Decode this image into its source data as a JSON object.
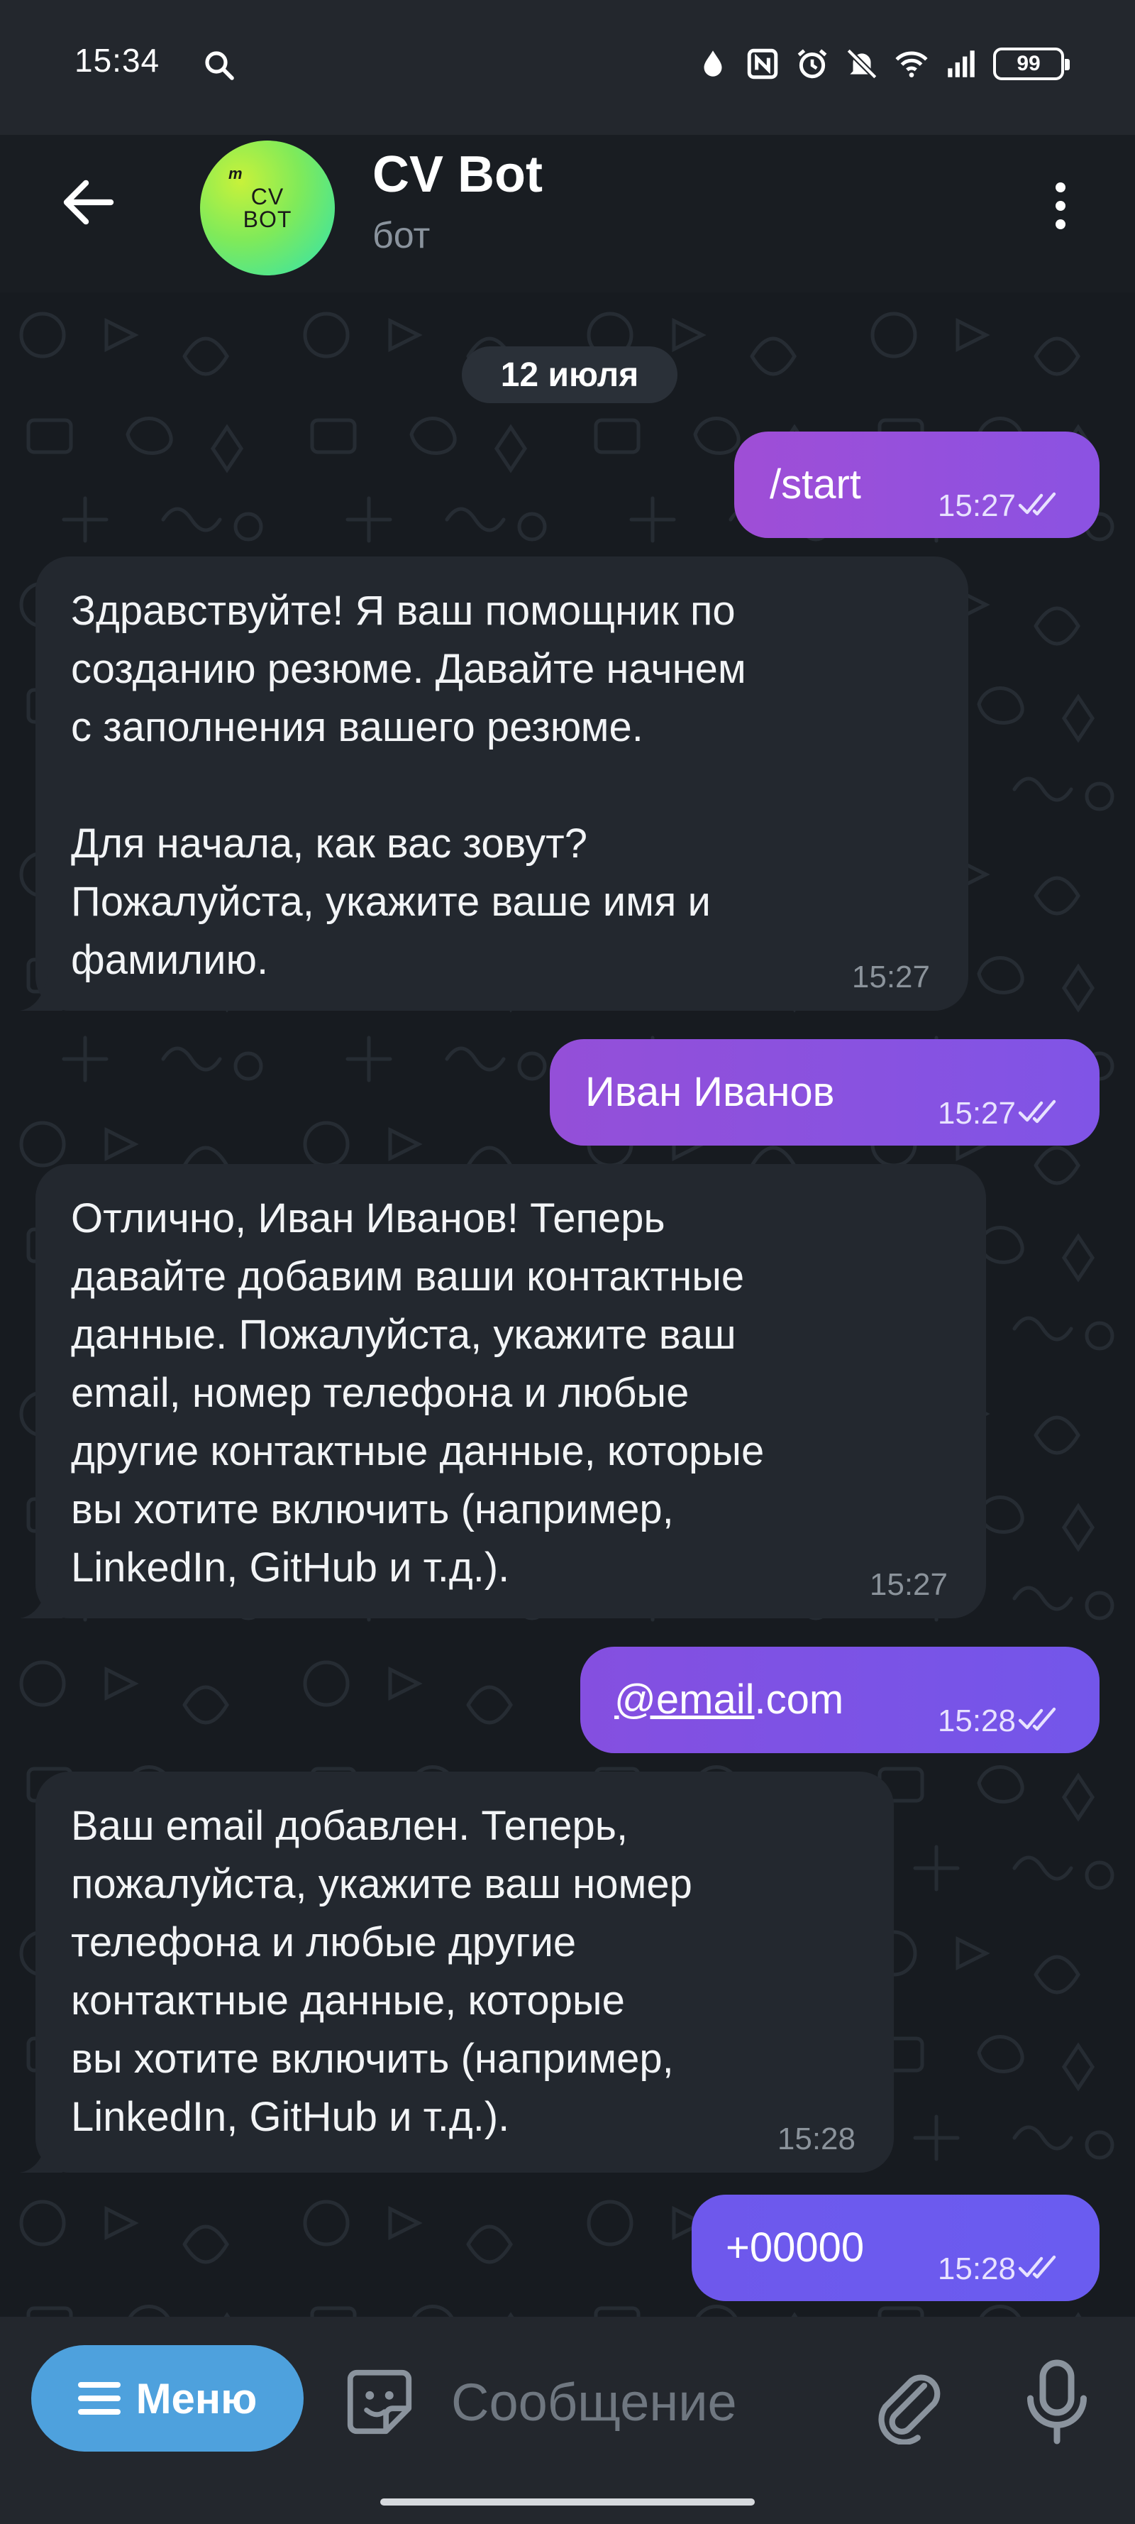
{
  "status_bar": {
    "time": "15:34",
    "battery": "99",
    "icons": [
      "search-icon",
      "drop-icon",
      "nfc-icon",
      "alarm-icon",
      "mute-icon",
      "wifi-icon",
      "signal-icon",
      "battery-icon"
    ]
  },
  "header": {
    "title": "CV Bot",
    "subtitle": "бот",
    "avatar_line1": "CV",
    "avatar_line2": "BOT",
    "avatar_mark": "m"
  },
  "date_separator": "12 июля",
  "messages": [
    {
      "direction": "outgoing",
      "text": "/start",
      "time": "15:27",
      "read": true
    },
    {
      "direction": "incoming",
      "text": "Здравствуйте! Я ваш помощник по\nсозданию резюме. Давайте начнем\nс заполнения вашего резюме.\n\nДля начала, как вас зовут?\nПожалуйста, укажите ваше имя и\nфамилию.",
      "time": "15:27"
    },
    {
      "direction": "outgoing",
      "text": "Иван Иванов",
      "time": "15:27",
      "read": true
    },
    {
      "direction": "incoming",
      "text": "Отлично, Иван Иванов! Теперь\nдавайте добавим ваши контактные\nданные. Пожалуйста, укажите ваш\nemail, номер телефона и любые\nдругие контактные данные, которые\nвы хотите включить (например,\nLinkedIn, GitHub и т.д.).",
      "time": "15:27"
    },
    {
      "direction": "outgoing",
      "text_link": "@email",
      "text_rest": ".com",
      "time": "15:28",
      "read": true
    },
    {
      "direction": "incoming",
      "text": "Ваш email добавлен. Теперь,\nпожалуйста, укажите ваш номер\nтелефона и любые другие\nконтактные данные, которые\nвы хотите включить (например,\nLinkedIn, GitHub и т.д.).",
      "time": "15:28"
    },
    {
      "direction": "outgoing",
      "text": "+00000",
      "time": "15:28",
      "read": true
    }
  ],
  "input_bar": {
    "menu_label": "Меню",
    "placeholder": "Сообщение"
  },
  "colors": {
    "background": "#171b20",
    "incoming_bubble": "#23282f",
    "outgoing_gradient_start": "#9b4fd4",
    "outgoing_gradient_end": "#6a5cf0",
    "accent": "#4ea1dd"
  }
}
